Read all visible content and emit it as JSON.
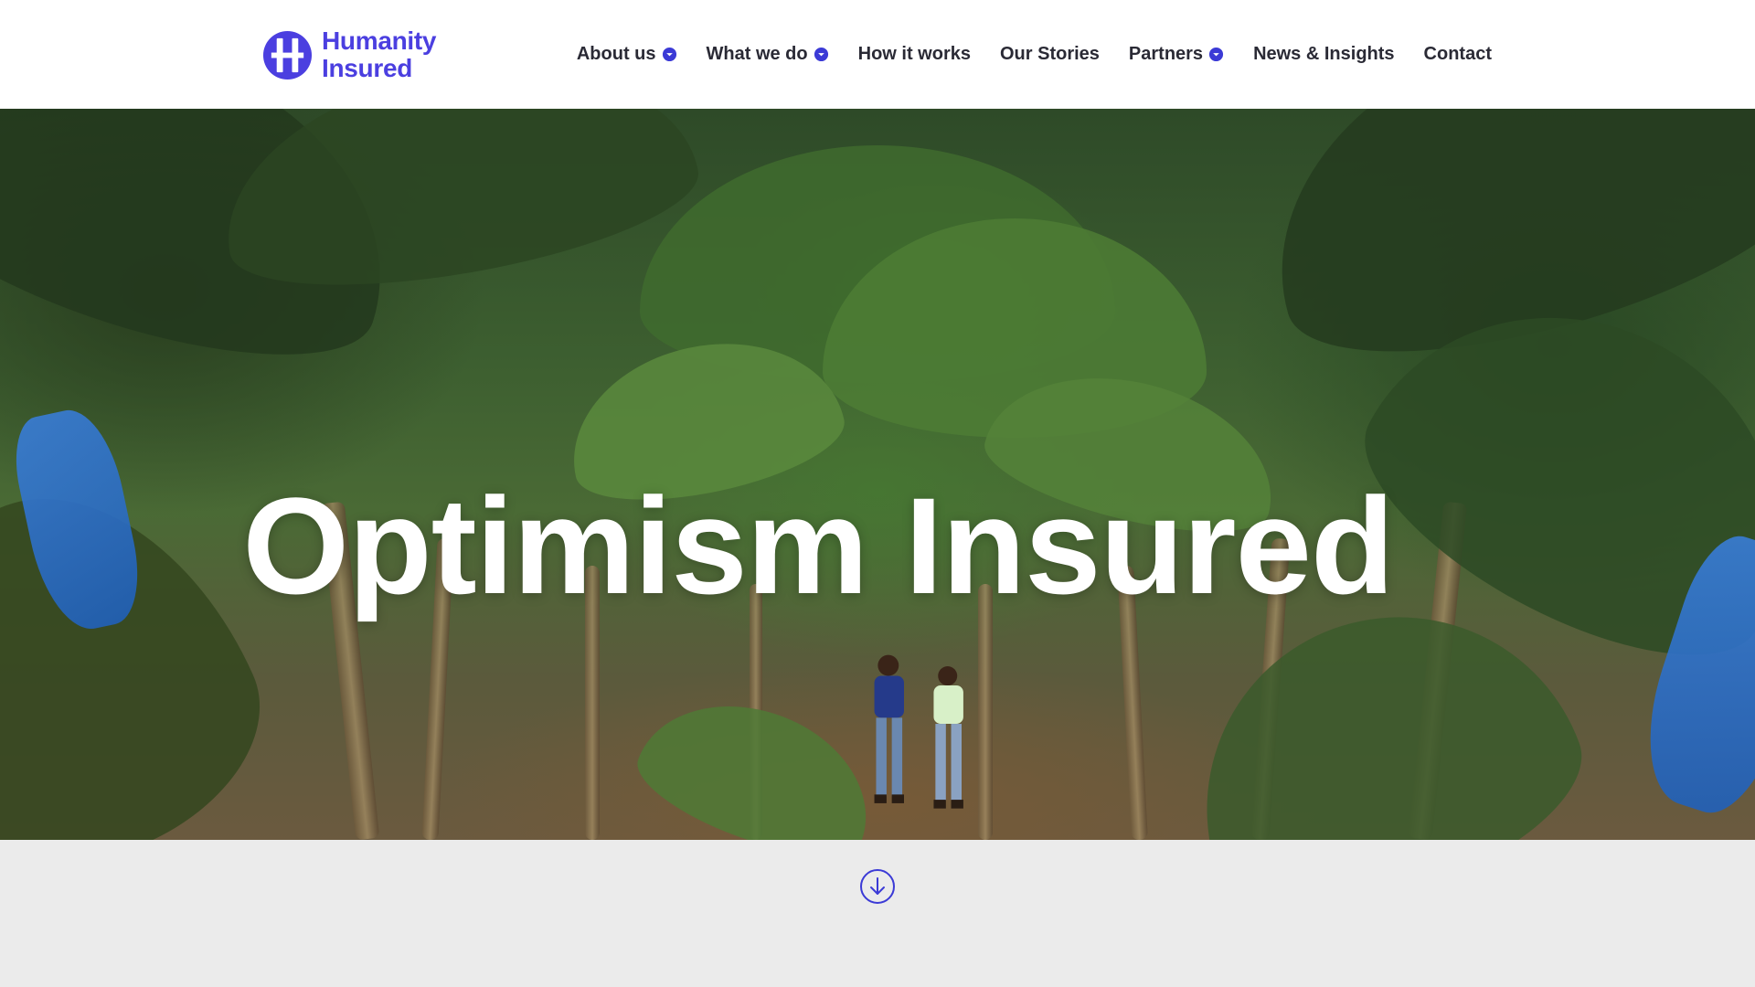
{
  "brand": {
    "name_line1": "Humanity",
    "name_line2": "Insured",
    "color": "#4b3fe0",
    "logo_icon": "humanity-insured-logo-icon"
  },
  "nav": {
    "items": [
      {
        "label": "About us",
        "has_dropdown": true
      },
      {
        "label": "What we do",
        "has_dropdown": true
      },
      {
        "label": "How it works",
        "has_dropdown": false
      },
      {
        "label": "Our Stories",
        "has_dropdown": false
      },
      {
        "label": "Partners",
        "has_dropdown": true
      },
      {
        "label": "News & Insights",
        "has_dropdown": false
      },
      {
        "label": "Contact",
        "has_dropdown": false
      }
    ],
    "dropdown_icon": "chevron-down-icon",
    "text_color": "#2a2a35"
  },
  "hero": {
    "title": "Optimism Insured",
    "background": "banana-plantation-photo"
  },
  "scroll": {
    "icon": "arrow-down-circle-icon",
    "section_color": "#ebebeb"
  }
}
